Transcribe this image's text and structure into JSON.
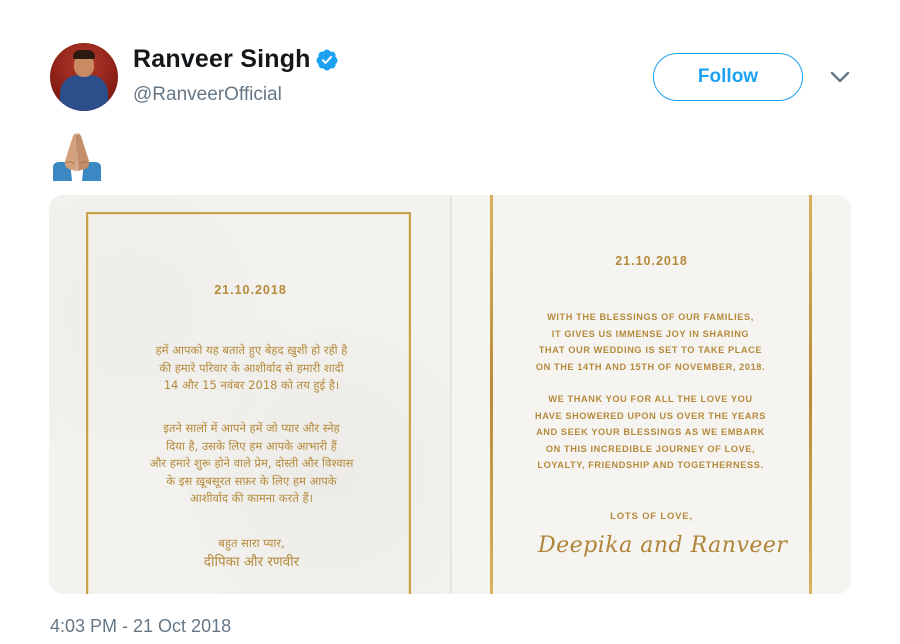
{
  "tweet": {
    "author": {
      "name": "Ranveer Singh",
      "handle": "@RanveerOfficial",
      "verified": true
    },
    "follow_label": "Follow",
    "text_emoji": "folded-hands-emoji",
    "timestamp": "4:03 PM - 21 Oct 2018",
    "accent_color": "#1da1f2"
  },
  "invitation": {
    "left_card": {
      "date": "21.10.2018",
      "paragraph1": [
        "हमें आपको यह बताते हुए बेहद ख़ुशी हो रही है",
        "की हमारे परिवार के आशीर्वाद से हमारी शादी",
        "14 और 15 नवंबर 2018 को तय हुई है।"
      ],
      "paragraph2": [
        "इतने सालों में आपने हमें जो प्यार और स्नेह",
        "दिया है, उसके लिए हम आपके आभारी हैं",
        "और हमारे शुरू होने वाले प्रेम, दोस्ती और विश्वास",
        "के इस ख़ूबसूरत सफ़र के लिए हम आपके",
        "आशीर्वाद की कामना करते हैं।"
      ],
      "closing": "बहुत सारा प्यार,",
      "signature": "दीपिका और रणवीर"
    },
    "right_card": {
      "date": "21.10.2018",
      "paragraph1": [
        "WITH THE BLESSINGS OF OUR FAMILIES,",
        "IT GIVES US IMMENSE JOY IN SHARING",
        "THAT OUR WEDDING IS SET TO TAKE PLACE",
        "ON THE 14TH AND 15TH OF NOVEMBER, 2018."
      ],
      "paragraph2": [
        "WE THANK YOU FOR ALL THE LOVE YOU",
        "HAVE SHOWERED UPON US OVER THE YEARS",
        "AND SEEK YOUR BLESSINGS AS WE EMBARK",
        "ON THIS INCREDIBLE JOURNEY OF LOVE,",
        "LOYALTY, FRIENDSHIP AND TOGETHERNESS."
      ],
      "closing": "LOTS OF LOVE,",
      "signature": "Deepika and Ranveer"
    },
    "gold_color": "#c9a24e"
  }
}
